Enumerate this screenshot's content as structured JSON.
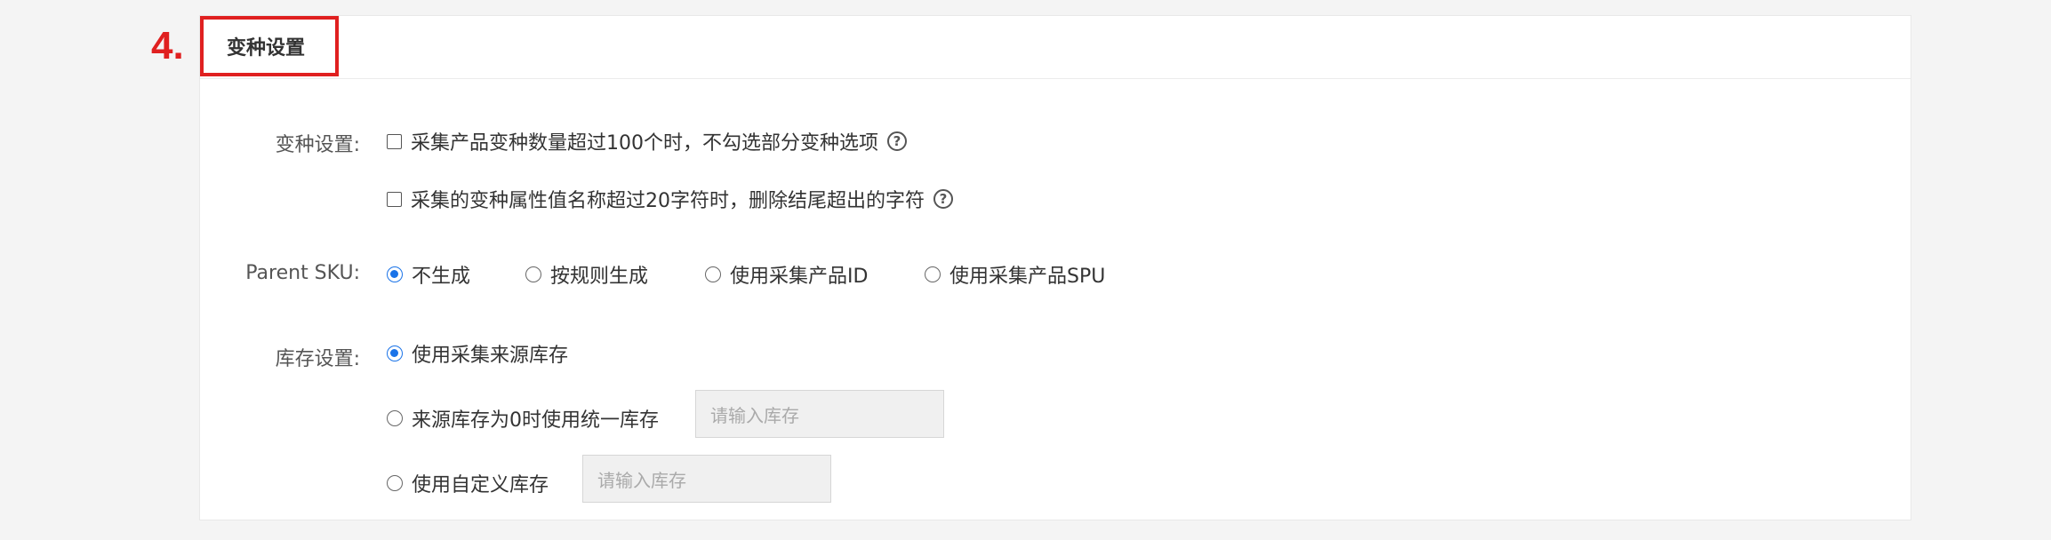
{
  "step": "4.",
  "section": {
    "title": "变种设置"
  },
  "variant": {
    "label": "变种设置:",
    "options": [
      {
        "text": "采集产品变种数量超过100个时，不勾选部分变种选项",
        "checked": false
      },
      {
        "text": "采集的变种属性值名称超过20字符时，删除结尾超出的字符",
        "checked": false
      }
    ],
    "help_icon": "?"
  },
  "parent_sku": {
    "label": "Parent SKU:",
    "options": [
      "不生成",
      "按规则生成",
      "使用采集产品ID",
      "使用采集产品SPU"
    ],
    "selected": "不生成"
  },
  "stock": {
    "label": "库存设置:",
    "options": [
      {
        "text": "使用采集来源库存",
        "selected": true
      },
      {
        "text": "来源库存为0时使用统一库存",
        "selected": false,
        "input_placeholder": "请输入库存"
      },
      {
        "text": "使用自定义库存",
        "selected": false,
        "input_placeholder": "请输入库存"
      }
    ]
  },
  "colors": {
    "accent": "#1a73e8",
    "highlight": "#e02020"
  }
}
